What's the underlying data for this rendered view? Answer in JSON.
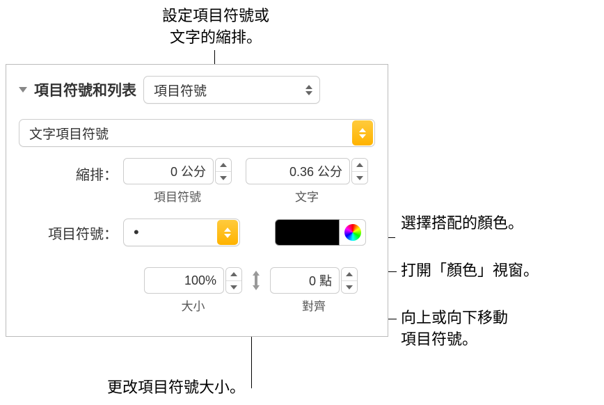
{
  "callouts": {
    "indent_title_l1": "設定項目符號或",
    "indent_title_l2": "文字的縮排。",
    "match_color": "選擇搭配的顏色。",
    "open_color": "打開「顏色」視窗。",
    "move_bullet_l1": "向上或向下移動",
    "move_bullet_l2": "項目符號。",
    "change_size": "更改項目符號大小。"
  },
  "panel": {
    "section_title": "項目符號和列表",
    "style_dropdown": "項目符號",
    "type_dropdown": "文字項目符號",
    "indent_label": "縮排：",
    "indent_bullet_value": "0 公分",
    "indent_bullet_sublabel": "項目符號",
    "indent_text_value": "0.36 公分",
    "indent_text_sublabel": "文字",
    "bullet_label": "項目符號：",
    "bullet_char": "•",
    "size_value": "100%",
    "size_sublabel": "大小",
    "align_value": "0 點",
    "align_sublabel": "對齊"
  }
}
